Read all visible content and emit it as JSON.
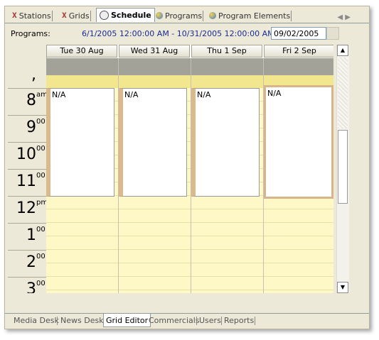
{
  "tabs": [
    {
      "label": "Stations",
      "icon": "wrench-icon"
    },
    {
      "label": "Grids",
      "icon": "wrench-icon"
    },
    {
      "label": "Schedule",
      "icon": "clock-icon",
      "active": true
    },
    {
      "label": "Programs",
      "icon": "globe-icon"
    },
    {
      "label": "Program Elements",
      "icon": "globe-icon"
    }
  ],
  "programs": {
    "label": "Programs:",
    "range": "6/1/2005 12:00:00 AM - 10/31/2005 12:00:00 AM",
    "date_value": "09/02/2005"
  },
  "days": [
    {
      "label": "Tue 30 Aug",
      "appt": "N/A"
    },
    {
      "label": "Wed 31 Aug",
      "appt": "N/A"
    },
    {
      "label": "Thu 1 Sep",
      "appt": "N/A"
    },
    {
      "label": "Fri 2 Sep",
      "appt": "N/A"
    }
  ],
  "hours": [
    {
      "num": "8",
      "sup": "am"
    },
    {
      "num": "9",
      "sup": "00"
    },
    {
      "num": "10",
      "sup": "00"
    },
    {
      "num": "11",
      "sup": "00"
    },
    {
      "num": "12",
      "sup": "pm"
    },
    {
      "num": "1",
      "sup": "00"
    },
    {
      "num": "2",
      "sup": "00"
    },
    {
      "num": "3",
      "sup": "00"
    }
  ],
  "bottom_tabs": [
    {
      "label": "Media Desk"
    },
    {
      "label": "News Desk"
    },
    {
      "label": "Grid Editor",
      "active": true
    },
    {
      "label": "Commercials"
    },
    {
      "label": "Users"
    },
    {
      "label": "Reports"
    }
  ],
  "colors": {
    "accent": "#dbb98a",
    "range_text": "#1a2a9a",
    "slot_yellow": "#fdf8c6"
  }
}
